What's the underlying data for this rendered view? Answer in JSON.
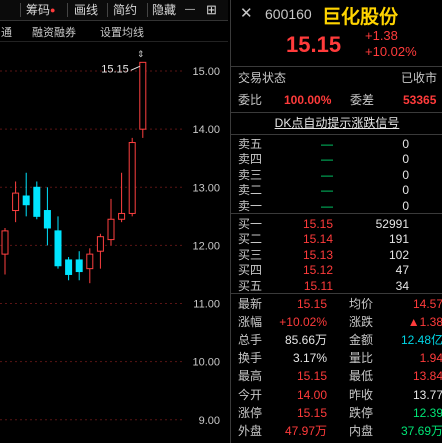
{
  "toolbar": {
    "items": [
      "筹码",
      "画线",
      "简约",
      "隐藏"
    ],
    "min_label": "—",
    "max_label": "⊞",
    "close_label": "✕"
  },
  "subbar": {
    "items": [
      "通",
      "融资融券",
      "设置均线"
    ]
  },
  "chart": {
    "y_ticks": [
      "15.00",
      "14.00",
      "13.00",
      "12.00",
      "11.00",
      "10.00",
      "9.00"
    ],
    "high_label": "15.15",
    "colors": {
      "up": "#ff4040",
      "down": "#00e5ff",
      "grid": "#5a1414"
    }
  },
  "chart_data": {
    "type": "candlestick",
    "ylim": [
      8.6,
      15.5
    ],
    "candles": [
      {
        "open": 11.85,
        "close": 12.25,
        "high": 12.3,
        "low": 11.5
      },
      {
        "open": 12.6,
        "close": 12.9,
        "high": 13.1,
        "low": 12.4
      },
      {
        "open": 12.85,
        "close": 12.7,
        "high": 13.25,
        "low": 12.5
      },
      {
        "open": 13.0,
        "close": 12.5,
        "high": 13.1,
        "low": 12.45
      },
      {
        "open": 12.6,
        "close": 12.3,
        "high": 13.0,
        "low": 12.0
      },
      {
        "open": 12.25,
        "close": 11.65,
        "high": 12.5,
        "low": 11.6
      },
      {
        "open": 11.75,
        "close": 11.5,
        "high": 11.8,
        "low": 11.4
      },
      {
        "open": 11.75,
        "close": 11.55,
        "high": 11.9,
        "low": 11.4
      },
      {
        "open": 11.6,
        "close": 11.85,
        "high": 11.95,
        "low": 11.35
      },
      {
        "open": 11.9,
        "close": 12.15,
        "high": 12.2,
        "low": 11.6
      },
      {
        "open": 12.1,
        "close": 12.45,
        "high": 12.8,
        "low": 12.0
      },
      {
        "open": 12.45,
        "close": 12.55,
        "high": 13.25,
        "low": 12.4
      },
      {
        "open": 12.55,
        "close": 13.77,
        "high": 13.85,
        "low": 12.5
      },
      {
        "open": 14.0,
        "close": 15.15,
        "high": 15.15,
        "low": 13.85
      }
    ]
  },
  "quote": {
    "code": "600160",
    "name": "巨化股份",
    "price": "15.15",
    "change": "+1.38",
    "change_pct": "+10.02%"
  },
  "status": {
    "label": "交易状态",
    "value": "已收市"
  },
  "weibi": {
    "label": "委比",
    "value": "100.00%",
    "label2": "委差",
    "value2": "53365"
  },
  "signal": "DK点自动提示涨跌信号",
  "sell": [
    {
      "label": "卖五",
      "price": "—",
      "vol": "0"
    },
    {
      "label": "卖四",
      "price": "—",
      "vol": "0"
    },
    {
      "label": "卖三",
      "price": "—",
      "vol": "0"
    },
    {
      "label": "卖二",
      "price": "—",
      "vol": "0"
    },
    {
      "label": "卖一",
      "price": "—",
      "vol": "0"
    }
  ],
  "buy": [
    {
      "label": "买一",
      "price": "15.15",
      "vol": "52991"
    },
    {
      "label": "买二",
      "price": "15.14",
      "vol": "191"
    },
    {
      "label": "买三",
      "price": "15.13",
      "vol": "102"
    },
    {
      "label": "买四",
      "price": "15.12",
      "vol": "47"
    },
    {
      "label": "买五",
      "price": "15.11",
      "vol": "34"
    }
  ],
  "stats": [
    {
      "l1": "最新",
      "v1": "15.15",
      "c1": "red",
      "l2": "均价",
      "v2": "14.57",
      "c2": "red"
    },
    {
      "l1": "涨幅",
      "v1": "+10.02%",
      "c1": "red",
      "l2": "涨跌",
      "v2": "▲1.38",
      "c2": "red"
    },
    {
      "l1": "总手",
      "v1": "85.66万",
      "c1": "white",
      "l2": "金额",
      "v2": "12.48亿",
      "c2": "cyan"
    },
    {
      "l1": "换手",
      "v1": "3.17%",
      "c1": "white",
      "l2": "量比",
      "v2": "1.94",
      "c2": "red"
    },
    {
      "l1": "最高",
      "v1": "15.15",
      "c1": "red",
      "l2": "最低",
      "v2": "13.84",
      "c2": "red"
    },
    {
      "l1": "今开",
      "v1": "14.00",
      "c1": "red",
      "l2": "昨收",
      "v2": "13.77",
      "c2": "white"
    },
    {
      "l1": "涨停",
      "v1": "15.15",
      "c1": "red",
      "l2": "跌停",
      "v2": "12.39",
      "c2": "green"
    },
    {
      "l1": "外盘",
      "v1": "47.97万",
      "c1": "red",
      "l2": "内盘",
      "v2": "37.69万",
      "c2": "green"
    }
  ]
}
